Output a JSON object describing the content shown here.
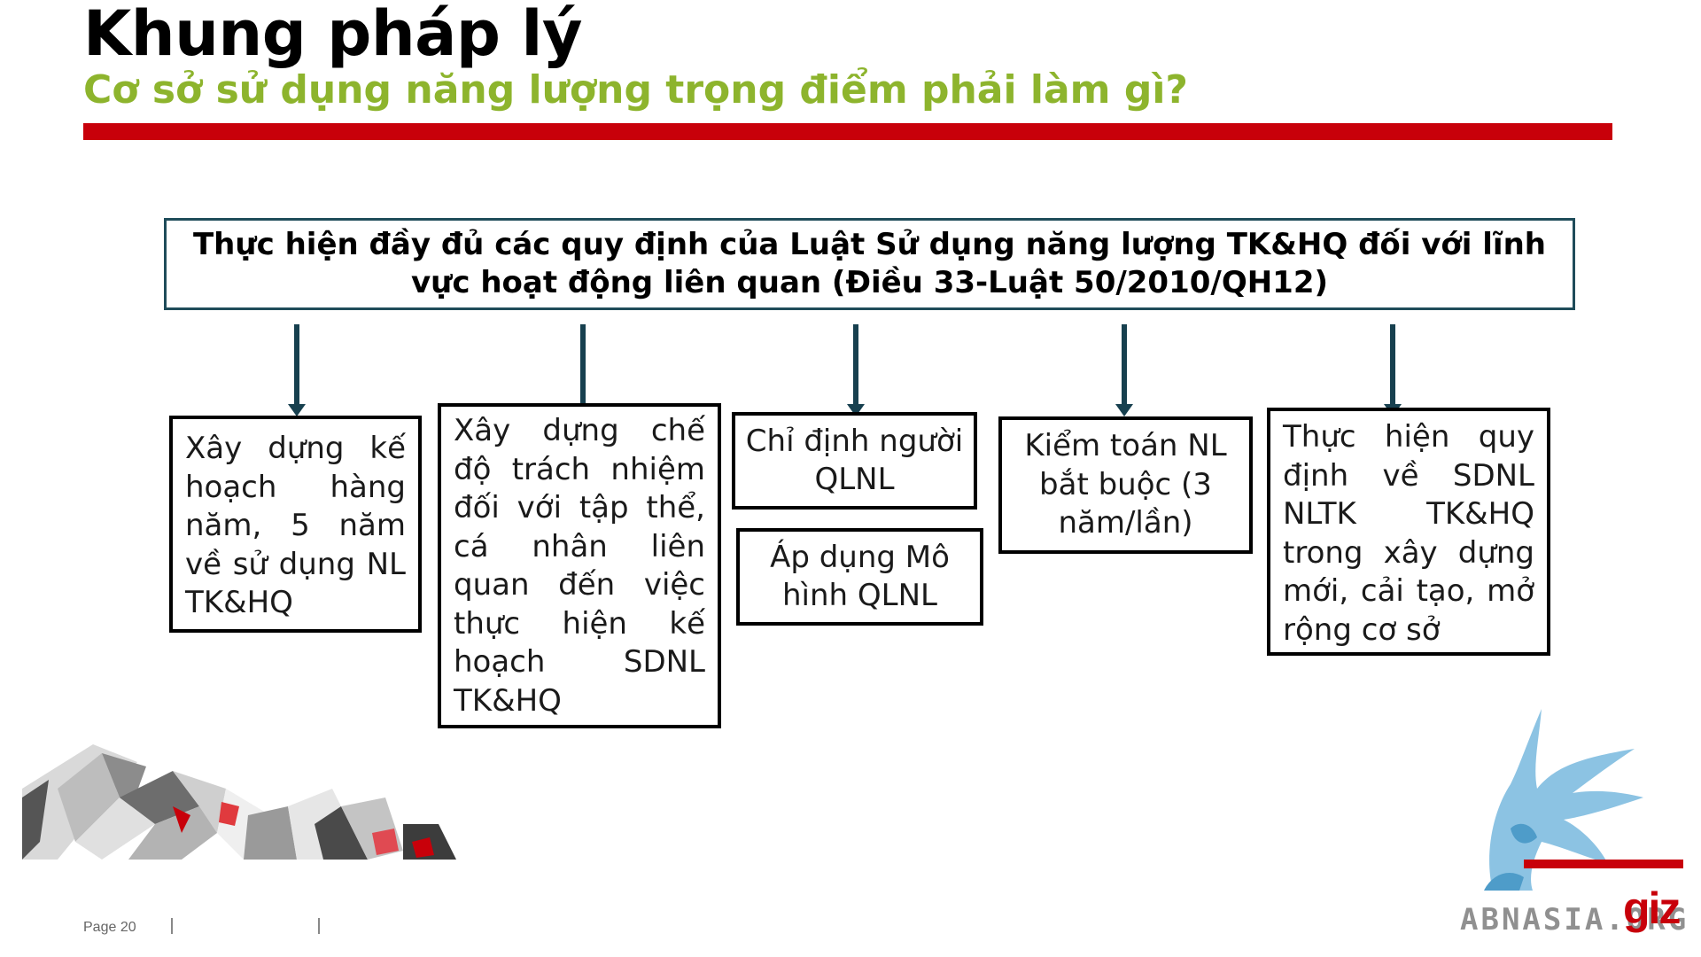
{
  "header": {
    "title": "Khung pháp lý",
    "subtitle": "Cơ sở sử dụng năng lượng trọng điểm phải làm gì?"
  },
  "diagram": {
    "top_box": "Thực hiện đầy đủ các quy định của Luật Sử dụng năng lượng TK&HQ đối với lĩnh vực hoạt động liên quan (Điều 33-Luật 50/2010/QH12)",
    "boxes": [
      "Xây dựng kế hoạch hàng năm, 5 năm về sử dụng NL TK&HQ",
      "Xây dựng chế độ trách nhiệm đối với tập thể, cá nhân liên quan đến việc thực hiện kế hoạch SDNL TK&HQ",
      "Chỉ định người QLNL",
      "Áp dụng Mô hình QLNL",
      "Kiểm toán NL bắt buộc (3 năm/lần)",
      "Thực hiện quy định về SDNL NLTK TK&HQ trong xây dựng mới, cải tạo, mở rộng cơ sở"
    ]
  },
  "footer": {
    "page": "Page 20"
  },
  "logo": {
    "giz": "giz",
    "watermark": "ABNASIA.ORG"
  },
  "colors": {
    "accent_green": "#8db42d",
    "accent_red": "#c8000a",
    "box_border_top": "#1f4c5a",
    "arrow": "#17404f",
    "eagle_blue": "#7fbde0"
  }
}
